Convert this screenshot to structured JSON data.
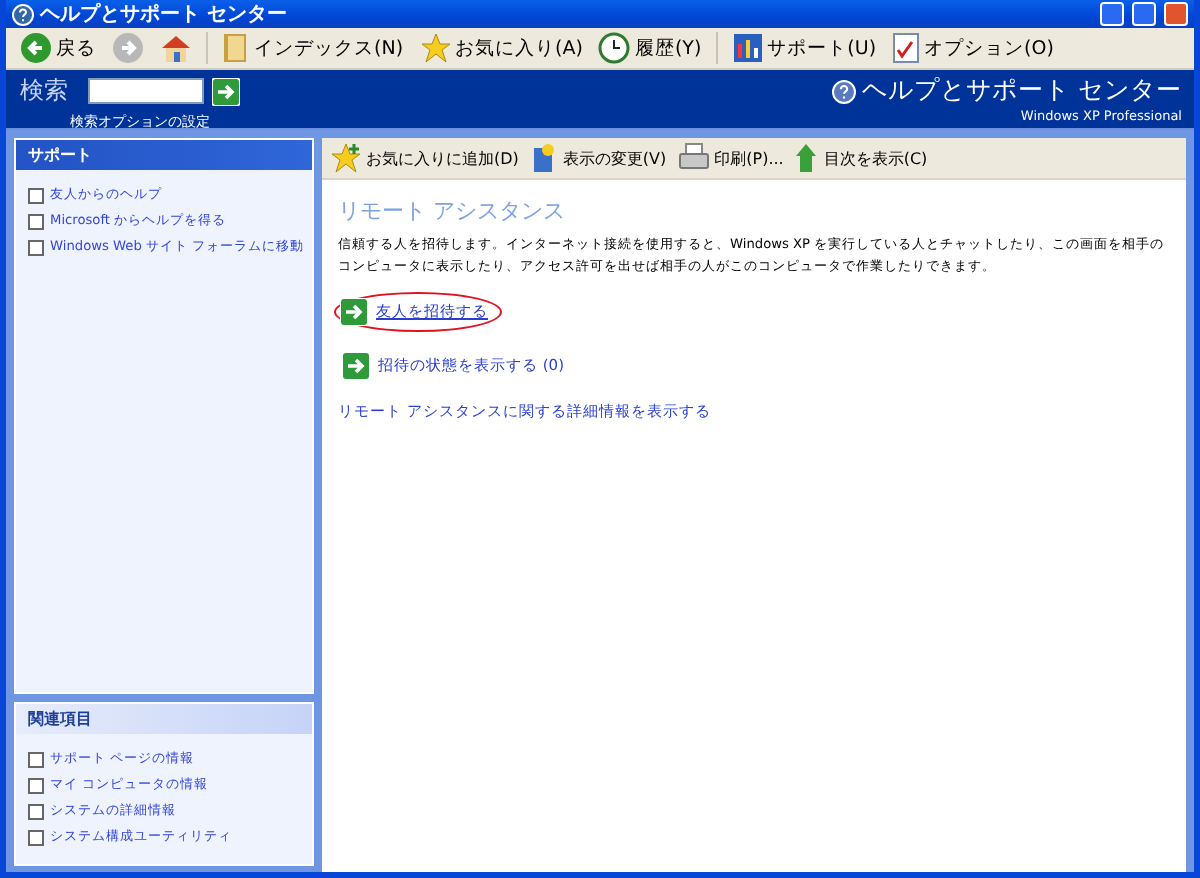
{
  "window": {
    "title": "ヘルプとサポート センター"
  },
  "toolbar": [
    {
      "kind": "back",
      "label": "戻る"
    },
    {
      "kind": "forward"
    },
    {
      "kind": "home"
    },
    {
      "kind": "index",
      "label": "インデックス(N)"
    },
    {
      "kind": "favorites",
      "label": "お気に入り(A)"
    },
    {
      "kind": "history",
      "label": "履歴(Y)"
    },
    {
      "kind": "support",
      "label": "サポート(U)"
    },
    {
      "kind": "options",
      "label": "オプション(O)"
    }
  ],
  "header": {
    "search_label": "検索",
    "search_options": "検索オプションの設定",
    "brand": "ヘルプとサポート センター",
    "edition": "Windows XP Professional"
  },
  "sidebar": [
    {
      "title": "サポート",
      "emphasis": true,
      "items": [
        "友人からのヘルプ",
        "Microsoft からヘルプを得る",
        "Windows Web サイト フォーラムに移動"
      ]
    },
    {
      "title": "関連項目",
      "emphasis": false,
      "items": [
        "サポート ページの情報",
        "マイ コンピュータの情報",
        "システムの詳細情報",
        "システム構成ユーティリティ"
      ]
    }
  ],
  "content_toolbar": [
    {
      "kind": "favorite",
      "label": "お気に入りに追加(D)"
    },
    {
      "kind": "view",
      "label": "表示の変更(V)"
    },
    {
      "kind": "print",
      "label": "印刷(P)..."
    },
    {
      "kind": "contents",
      "label": "目次を表示(C)"
    }
  ],
  "content": {
    "heading": "リモート アシスタンス",
    "text": "信頼する人を招待します。インターネット接続を使用すると、Windows XP を実行している人とチャットしたり、この画面を相手のコンピュータに表示したり、アクセス許可を出せば相手の人がこのコンピュータで作業したりできます。",
    "actions": [
      {
        "label": "友人を招待する",
        "circled": true
      },
      {
        "label": "招待の状態を表示する (0)",
        "circled": false
      }
    ],
    "more_link": "リモート アシスタンスに関する詳細情報を表示する"
  }
}
